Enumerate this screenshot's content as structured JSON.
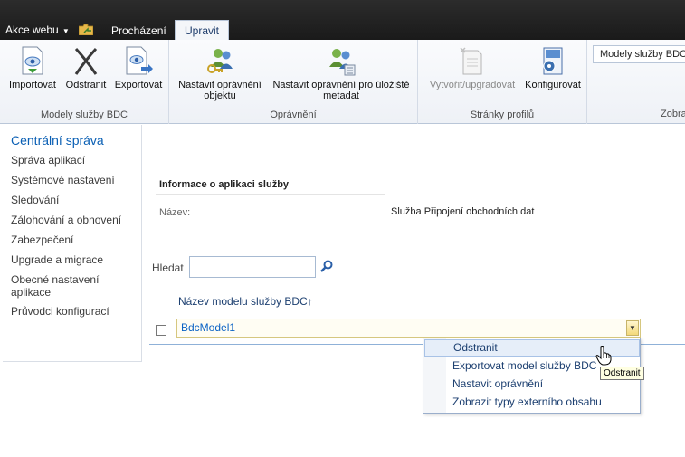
{
  "topbar": {
    "site_actions": "Akce webu",
    "tabs": [
      {
        "label": "Procházení"
      },
      {
        "label": "Upravit"
      }
    ]
  },
  "ribbon": {
    "groups": [
      {
        "title": "Modely služby BDC",
        "buttons": [
          {
            "label": "Importovat",
            "icon": "import-icon"
          },
          {
            "label": "Odstranit",
            "icon": "delete-icon"
          },
          {
            "label": "Exportovat",
            "icon": "export-icon"
          }
        ]
      },
      {
        "title": "Oprávnění",
        "buttons": [
          {
            "label_line1": "Nastavit oprávnění",
            "label_line2": "objektu",
            "icon": "set-permissions-icon"
          },
          {
            "label_line1": "Nastavit oprávnění pro úložiště",
            "label_line2": "metadat",
            "icon": "metadata-permissions-icon"
          }
        ]
      },
      {
        "title": "Stránky profilů",
        "buttons": [
          {
            "label": "Vytvořit/upgradovat",
            "icon": "create-upgrade-icon",
            "disabled": true
          },
          {
            "label": "Konfigurovat",
            "icon": "configure-icon"
          }
        ]
      },
      {
        "title": "Zobra",
        "select_value": "Modely služby BDC"
      }
    ]
  },
  "nav": {
    "heading": "Centrální správa",
    "items": [
      "Správa aplikací",
      "Systémové nastavení",
      "Sledování",
      "Zálohování a obnovení",
      "Zabezpečení",
      "Upgrade a migrace",
      "Obecné nastavení aplikace",
      "Průvodci konfigurací"
    ]
  },
  "info": {
    "heading": "Informace o aplikaci služby",
    "name_label": "Název:",
    "name_value": "Služba Připojení obchodních dat"
  },
  "search": {
    "label": "Hledat",
    "value": ""
  },
  "list": {
    "column_header": "Název modelu služby BDC↑",
    "rows": [
      {
        "name": "BdcModel1"
      }
    ]
  },
  "context_menu": {
    "items": [
      "Odstranit",
      "Exportovat model služby BDC",
      "Nastavit oprávnění",
      "Zobrazit typy externího obsahu"
    ],
    "highlighted_index": 0
  },
  "tooltip": "Odstranit",
  "colors": {
    "topbar": "#1f1f1f",
    "link": "#0b63c5",
    "nav_heading": "#0a5fb4",
    "menu_highlight": "#e6eef9"
  }
}
